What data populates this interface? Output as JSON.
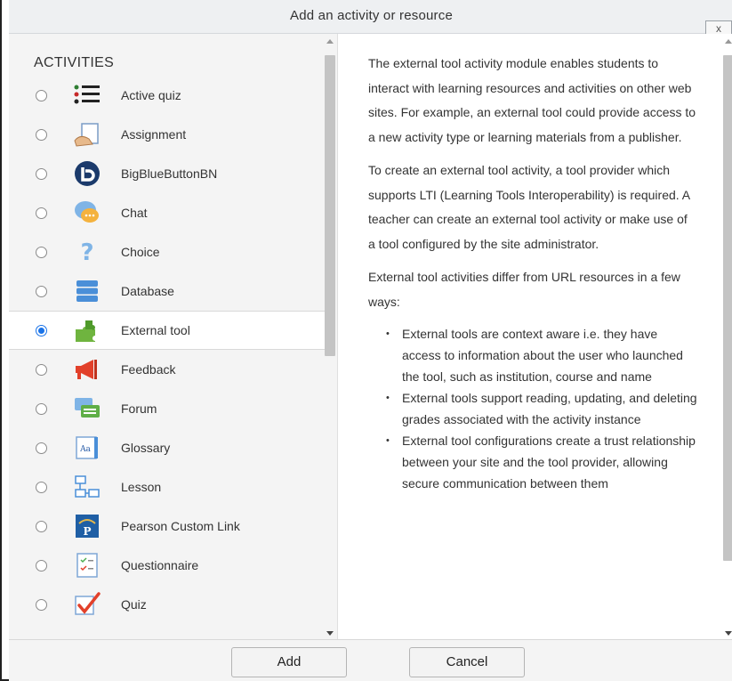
{
  "dialog": {
    "title": "Add an activity or resource",
    "close_label": "x"
  },
  "activities": {
    "heading": "ACTIVITIES",
    "items": [
      {
        "label": "Active quiz",
        "icon": "list-icon",
        "selected": false
      },
      {
        "label": "Assignment",
        "icon": "assignment-icon",
        "selected": false
      },
      {
        "label": "BigBlueButtonBN",
        "icon": "bigbluebutton-icon",
        "selected": false
      },
      {
        "label": "Chat",
        "icon": "chat-icon",
        "selected": false
      },
      {
        "label": "Choice",
        "icon": "question-icon",
        "selected": false
      },
      {
        "label": "Database",
        "icon": "database-icon",
        "selected": false
      },
      {
        "label": "External tool",
        "icon": "puzzle-icon",
        "selected": true
      },
      {
        "label": "Feedback",
        "icon": "megaphone-icon",
        "selected": false
      },
      {
        "label": "Forum",
        "icon": "forum-icon",
        "selected": false
      },
      {
        "label": "Glossary",
        "icon": "glossary-icon",
        "selected": false
      },
      {
        "label": "Lesson",
        "icon": "lesson-icon",
        "selected": false
      },
      {
        "label": "Pearson Custom Link",
        "icon": "pearson-icon",
        "selected": false
      },
      {
        "label": "Questionnaire",
        "icon": "questionnaire-icon",
        "selected": false
      },
      {
        "label": "Quiz",
        "icon": "quiz-check-icon",
        "selected": false
      }
    ]
  },
  "description": {
    "p1": "The external tool activity module enables students to interact with learning resources and activities on other web sites. For example, an external tool could provide access to a new activity type or learning materials from a publisher.",
    "p2": "To create an external tool activity, a tool provider which supports LTI (Learning Tools Interoperability) is required. A teacher can create an external tool activity or make use of a tool configured by the site administrator.",
    "p3": "External tool activities differ from URL resources in a few ways:",
    "bullets": [
      "External tools are context aware i.e. they have access to information about the user who launched the tool, such as institution, course and name",
      "External tools support reading, updating, and deleting grades associated with the activity instance",
      "External tool configurations create a trust relationship between your site and the tool provider, allowing secure communication between them"
    ]
  },
  "footer": {
    "add_label": "Add",
    "cancel_label": "Cancel"
  },
  "colors": {
    "accent": "#1a73e8",
    "panel_bg": "#f4f4f4"
  }
}
